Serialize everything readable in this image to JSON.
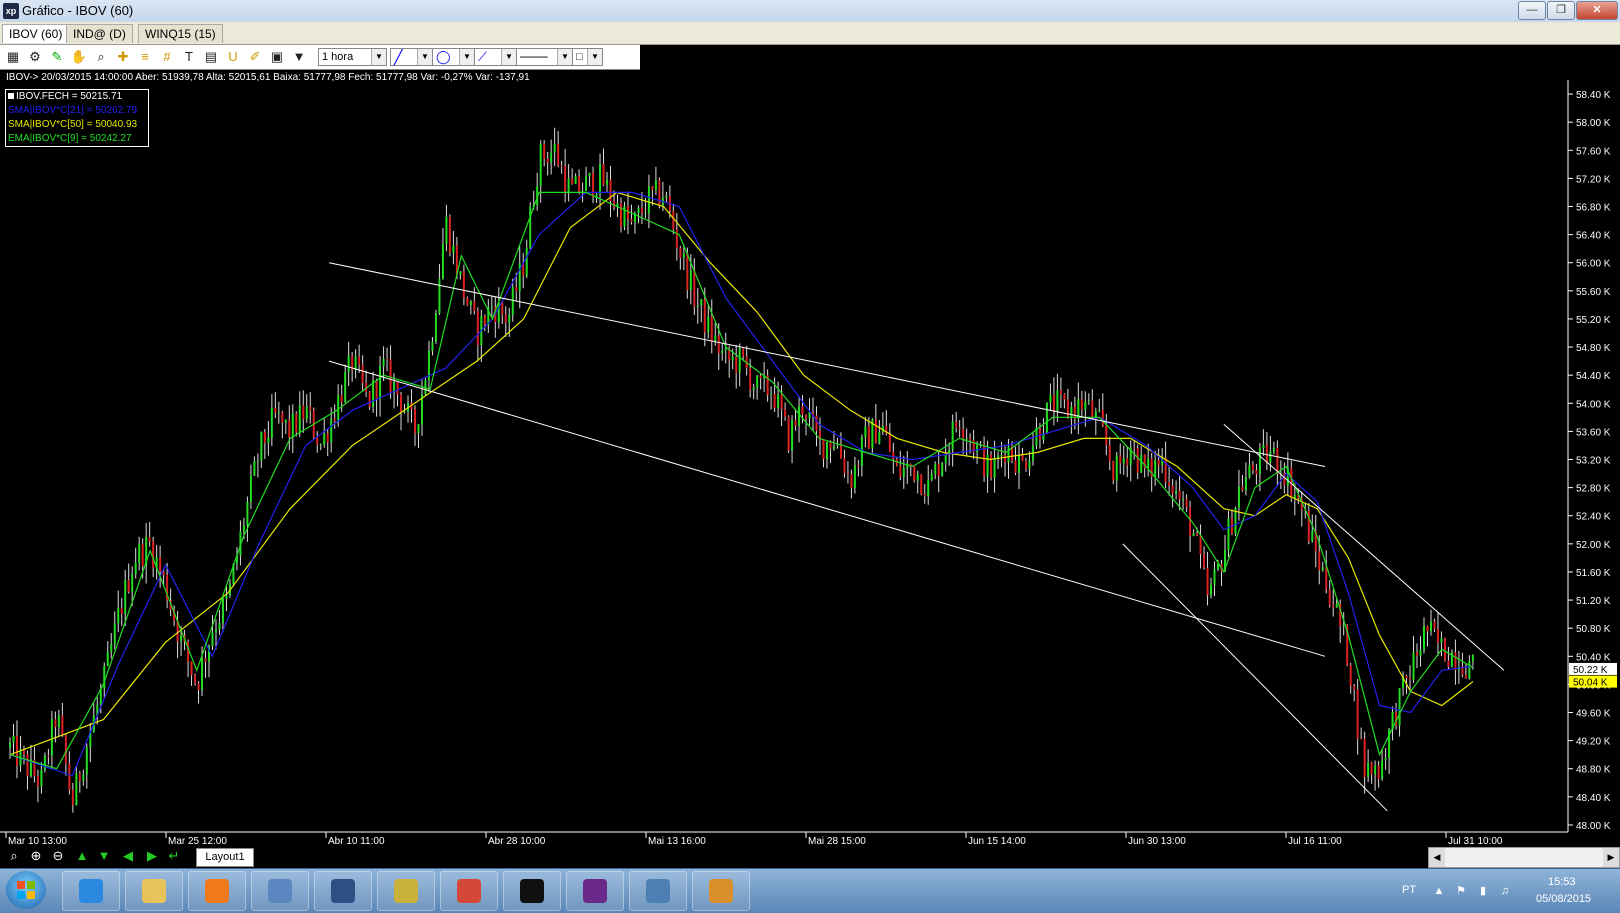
{
  "window": {
    "title": "Gráfico - IBOV (60)",
    "app_icon_text": "xp",
    "minimize": "—",
    "maximize": "❐",
    "close": "✕"
  },
  "tabs": [
    {
      "label": "IBOV (60)",
      "active": true
    },
    {
      "label": "IND@ (D)",
      "active": false
    },
    {
      "label": "WINQ15 (15)",
      "active": false
    }
  ],
  "toolbar": {
    "icons": [
      "chart-icon",
      "settings-icon",
      "zoom-tool-icon",
      "hand-icon",
      "magnifier-icon",
      "crosshair-icon",
      "horizontal-lines-icon",
      "grid-icon",
      "text-icon",
      "calculator-icon",
      "magnet-icon",
      "brush-icon",
      "trash-icon",
      "filter-icon"
    ],
    "period_value": "1 hora"
  },
  "info_line": "IBOV-> 20/03/2015 14:00:00 Aber: 51939,78 Alta: 52015,61 Baixa: 51777,98 Fech: 51777,98 Var: -0,27% Var: -137,91",
  "legend": [
    {
      "text": "IBOV.FECH = 50215.71",
      "color": "#ffffff"
    },
    {
      "text": "SMA|IBOV*C[21] = 50262.79",
      "color": "#2222ee"
    },
    {
      "text": "SMA|IBOV*C[50] = 50040.93",
      "color": "#e6e600"
    },
    {
      "text": "EMA|IBOV*C[9] = 50242.27",
      "color": "#22dd22"
    }
  ],
  "chart_data": {
    "type": "candlestick",
    "title": "",
    "y_axis": {
      "unit": "K",
      "ylim": [
        47.9,
        58.6
      ],
      "ticks": [
        "58.40 K",
        "58.00 K",
        "57.60 K",
        "57.20 K",
        "56.80 K",
        "56.40 K",
        "56.00 K",
        "55.60 K",
        "55.20 K",
        "54.80 K",
        "54.40 K",
        "54.00 K",
        "53.60 K",
        "53.20 K",
        "52.80 K",
        "52.40 K",
        "52.00 K",
        "51.60 K",
        "51.20 K",
        "50.80 K",
        "50.40 K",
        "50.00 K",
        "49.60 K",
        "49.20 K",
        "48.80 K",
        "48.40 K",
        "48.00 K"
      ],
      "tick_values": [
        58.4,
        58.0,
        57.6,
        57.2,
        56.8,
        56.4,
        56.0,
        55.6,
        55.2,
        54.8,
        54.4,
        54.0,
        53.6,
        53.2,
        52.8,
        52.4,
        52.0,
        51.6,
        51.2,
        50.8,
        50.4,
        50.0,
        49.6,
        49.2,
        48.8,
        48.4,
        48.0
      ],
      "current_labels": [
        {
          "text": "50.22 K",
          "value": 50.22,
          "bg": "#ffffff"
        },
        {
          "text": "50.04 K",
          "value": 50.04,
          "bg": "#ffff00"
        }
      ]
    },
    "x_axis": {
      "ticks": [
        "Mar 10 13:00",
        "Mar 25 12:00",
        "Abr 10 11:00",
        "Abr 28 10:00",
        "Mai 13 16:00",
        "Mai 28 15:00",
        "Jun 15 14:00",
        "Jun 30 13:00",
        "Jul 16 11:00",
        "Jul 31 10:00"
      ]
    },
    "close_path": [
      [
        0,
        49.1
      ],
      [
        2,
        48.6
      ],
      [
        3,
        49.6
      ],
      [
        4,
        48.3
      ],
      [
        5,
        49.2
      ],
      [
        6,
        50.0
      ],
      [
        7,
        51.0
      ],
      [
        8,
        51.8
      ],
      [
        9,
        52.0
      ],
      [
        10,
        51.4
      ],
      [
        11,
        50.6
      ],
      [
        12,
        50.0
      ],
      [
        13,
        50.8
      ],
      [
        14,
        51.2
      ],
      [
        15,
        52.3
      ],
      [
        16,
        53.3
      ],
      [
        17,
        53.8
      ],
      [
        18,
        53.6
      ],
      [
        19,
        53.9
      ],
      [
        20,
        53.4
      ],
      [
        21,
        54.0
      ],
      [
        22,
        54.6
      ],
      [
        23,
        54.0
      ],
      [
        24,
        54.5
      ],
      [
        25,
        54.1
      ],
      [
        26,
        53.6
      ],
      [
        27,
        54.8
      ],
      [
        28,
        56.6
      ],
      [
        29,
        55.7
      ],
      [
        30,
        55.0
      ],
      [
        31,
        55.4
      ],
      [
        32,
        55.2
      ],
      [
        33,
        56.0
      ],
      [
        34,
        57.5
      ],
      [
        35,
        57.6
      ],
      [
        36,
        57.0
      ],
      [
        37,
        57.1
      ],
      [
        38,
        57.2
      ],
      [
        39,
        56.8
      ],
      [
        40,
        56.5
      ],
      [
        41,
        56.9
      ],
      [
        42,
        57.0
      ],
      [
        43,
        56.2
      ],
      [
        44,
        55.5
      ],
      [
        45,
        55.0
      ],
      [
        46,
        54.6
      ],
      [
        47,
        54.6
      ],
      [
        48,
        54.2
      ],
      [
        49,
        54.2
      ],
      [
        50,
        53.5
      ],
      [
        51,
        54.0
      ],
      [
        52,
        53.4
      ],
      [
        53,
        53.5
      ],
      [
        54,
        52.9
      ],
      [
        55,
        53.5
      ],
      [
        56,
        53.7
      ],
      [
        57,
        53.0
      ],
      [
        58,
        53.1
      ],
      [
        59,
        52.8
      ],
      [
        60,
        53.3
      ],
      [
        61,
        53.8
      ],
      [
        62,
        53.4
      ],
      [
        63,
        53.0
      ],
      [
        64,
        53.4
      ],
      [
        65,
        53.1
      ],
      [
        66,
        53.6
      ],
      [
        67,
        54.0
      ],
      [
        68,
        53.9
      ],
      [
        69,
        54.0
      ],
      [
        70,
        53.7
      ],
      [
        71,
        53.0
      ],
      [
        72,
        53.4
      ],
      [
        73,
        53.0
      ],
      [
        74,
        53.2
      ],
      [
        75,
        52.7
      ],
      [
        76,
        52.2
      ],
      [
        77,
        51.2
      ],
      [
        78,
        51.9
      ],
      [
        79,
        52.8
      ],
      [
        80,
        53.1
      ],
      [
        81,
        53.3
      ],
      [
        82,
        53.0
      ],
      [
        83,
        52.5
      ],
      [
        84,
        51.8
      ],
      [
        85,
        51.2
      ],
      [
        86,
        50.4
      ],
      [
        87,
        48.8
      ],
      [
        88,
        48.8
      ],
      [
        89,
        49.6
      ],
      [
        90,
        50.2
      ],
      [
        91,
        50.8
      ],
      [
        92,
        50.5
      ],
      [
        93,
        50.4
      ],
      [
        94,
        50.22
      ]
    ],
    "ema9": [
      [
        0,
        49.0
      ],
      [
        3,
        48.8
      ],
      [
        6,
        50.0
      ],
      [
        9,
        51.9
      ],
      [
        12,
        50.2
      ],
      [
        15,
        52.1
      ],
      [
        18,
        53.5
      ],
      [
        21,
        53.9
      ],
      [
        24,
        54.4
      ],
      [
        27,
        54.2
      ],
      [
        29,
        56.1
      ],
      [
        31,
        55.2
      ],
      [
        34,
        57.0
      ],
      [
        37,
        57.0
      ],
      [
        40,
        56.7
      ],
      [
        43,
        56.4
      ],
      [
        46,
        54.8
      ],
      [
        49,
        54.3
      ],
      [
        52,
        53.5
      ],
      [
        55,
        53.3
      ],
      [
        58,
        53.1
      ],
      [
        61,
        53.5
      ],
      [
        64,
        53.3
      ],
      [
        67,
        53.8
      ],
      [
        70,
        53.8
      ],
      [
        73,
        53.1
      ],
      [
        76,
        52.3
      ],
      [
        78,
        51.6
      ],
      [
        80,
        52.8
      ],
      [
        82,
        53.1
      ],
      [
        84,
        52.1
      ],
      [
        86,
        50.7
      ],
      [
        88,
        49.0
      ],
      [
        90,
        49.9
      ],
      [
        92,
        50.5
      ],
      [
        94,
        50.24
      ]
    ],
    "sma21": [
      [
        0,
        49.0
      ],
      [
        4,
        48.7
      ],
      [
        7,
        50.3
      ],
      [
        10,
        51.7
      ],
      [
        13,
        50.4
      ],
      [
        16,
        52.0
      ],
      [
        19,
        53.4
      ],
      [
        22,
        53.9
      ],
      [
        25,
        54.2
      ],
      [
        28,
        54.5
      ],
      [
        31,
        55.2
      ],
      [
        34,
        56.4
      ],
      [
        37,
        57.0
      ],
      [
        40,
        57.0
      ],
      [
        43,
        56.8
      ],
      [
        46,
        55.5
      ],
      [
        49,
        54.6
      ],
      [
        52,
        53.7
      ],
      [
        55,
        53.3
      ],
      [
        58,
        53.2
      ],
      [
        61,
        53.3
      ],
      [
        64,
        53.4
      ],
      [
        67,
        53.6
      ],
      [
        70,
        53.8
      ],
      [
        73,
        53.4
      ],
      [
        76,
        52.8
      ],
      [
        78,
        52.2
      ],
      [
        80,
        52.4
      ],
      [
        82,
        53.0
      ],
      [
        84,
        52.6
      ],
      [
        86,
        51.3
      ],
      [
        88,
        49.7
      ],
      [
        90,
        49.6
      ],
      [
        92,
        50.2
      ],
      [
        94,
        50.26
      ]
    ],
    "sma50": [
      [
        0,
        49.0
      ],
      [
        6,
        49.5
      ],
      [
        10,
        50.6
      ],
      [
        14,
        51.3
      ],
      [
        18,
        52.5
      ],
      [
        22,
        53.4
      ],
      [
        26,
        54.0
      ],
      [
        30,
        54.6
      ],
      [
        33,
        55.2
      ],
      [
        36,
        56.5
      ],
      [
        39,
        57.0
      ],
      [
        42,
        56.8
      ],
      [
        45,
        56.0
      ],
      [
        48,
        55.3
      ],
      [
        51,
        54.4
      ],
      [
        54,
        53.9
      ],
      [
        57,
        53.5
      ],
      [
        60,
        53.3
      ],
      [
        63,
        53.2
      ],
      [
        66,
        53.3
      ],
      [
        69,
        53.5
      ],
      [
        72,
        53.5
      ],
      [
        75,
        53.1
      ],
      [
        78,
        52.5
      ],
      [
        80,
        52.4
      ],
      [
        82,
        52.7
      ],
      [
        84,
        52.5
      ],
      [
        86,
        51.8
      ],
      [
        88,
        50.7
      ],
      [
        90,
        49.9
      ],
      [
        92,
        49.7
      ],
      [
        94,
        50.04
      ]
    ],
    "trendlines": [
      {
        "from": [
          20.5,
          56.0
        ],
        "to": [
          84.5,
          53.1
        ],
        "color": "#ffffff"
      },
      {
        "from": [
          20.5,
          54.6
        ],
        "to": [
          84.5,
          50.4
        ],
        "color": "#ffffff"
      },
      {
        "from": [
          71.5,
          52.0
        ],
        "to": [
          88.5,
          48.2
        ],
        "color": "#ffffff"
      },
      {
        "from": [
          78,
          53.7
        ],
        "to": [
          96,
          50.2
        ],
        "color": "#ffffff"
      }
    ]
  },
  "bottom": {
    "icons": [
      "zoom-fit-icon",
      "zoom-in-icon",
      "zoom-out-icon",
      "arrow-up-icon",
      "arrow-down-icon",
      "arrow-left-icon",
      "arrow-right-icon",
      "arrow-return-icon"
    ],
    "layout_tab": "Layout1"
  },
  "taskbar": {
    "apps": [
      {
        "name": "internet-explorer-icon",
        "color": "#2b8ae0"
      },
      {
        "name": "file-explorer-icon",
        "color": "#e8c35a"
      },
      {
        "name": "media-player-icon",
        "color": "#f07a1b"
      },
      {
        "name": "network-app-icon",
        "color": "#5b86c0"
      },
      {
        "name": "hp-app-icon",
        "color": "#2d4f84"
      },
      {
        "name": "archive-app-icon",
        "color": "#c9b13a"
      },
      {
        "name": "chrome-icon",
        "color": "#d34836"
      },
      {
        "name": "xp-app-icon",
        "color": "#111111"
      },
      {
        "name": "profit-app-icon",
        "color": "#6b2a8a"
      },
      {
        "name": "photo-app-icon",
        "color": "#4d7fb5"
      },
      {
        "name": "paint-app-icon",
        "color": "#d98f2b"
      }
    ],
    "language": "PT",
    "time": "15:53",
    "date": "05/08/2015"
  }
}
